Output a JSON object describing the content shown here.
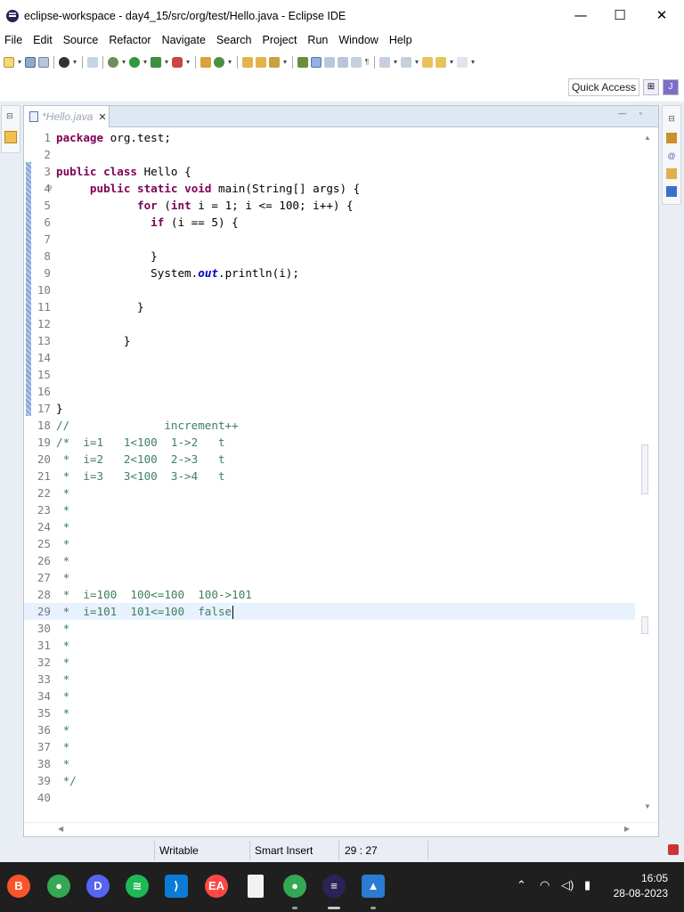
{
  "window": {
    "title": "eclipse-workspace - day4_15/src/org/test/Hello.java - Eclipse IDE",
    "minimize_glyph": "—",
    "maximize_glyph": "☐",
    "close_glyph": "✕"
  },
  "menu": [
    "File",
    "Edit",
    "Source",
    "Refactor",
    "Navigate",
    "Search",
    "Project",
    "Run",
    "Window",
    "Help"
  ],
  "toolbar": {
    "quick_access_label": "Quick Access"
  },
  "editor": {
    "tab_label": "*Hello.java",
    "tab_close_glyph": "✕",
    "lines": [
      {
        "n": "1",
        "html": "<span class=\"kw\">package</span> org.test;"
      },
      {
        "n": "2",
        "html": ""
      },
      {
        "n": "3",
        "html": "<span class=\"kw\">public</span> <span class=\"kw\">class</span> Hello {"
      },
      {
        "n": "4",
        "fold": "⊖",
        "html": "     <span class=\"kw\">public</span> <span class=\"kw\">static</span> <span class=\"kw\">void</span> main(String[] args) {"
      },
      {
        "n": "5",
        "html": "            <span class=\"kw\">for</span> (<span class=\"kw\">int</span> i = 1; i &lt;= 100; i++) {"
      },
      {
        "n": "6",
        "html": "              <span class=\"kw\">if</span> (i == 5) {"
      },
      {
        "n": "7",
        "html": ""
      },
      {
        "n": "8",
        "html": "              }"
      },
      {
        "n": "9",
        "html": "              System.<span class=\"fld\">out</span>.println(i);"
      },
      {
        "n": "10",
        "html": ""
      },
      {
        "n": "11",
        "html": "            }"
      },
      {
        "n": "12",
        "html": ""
      },
      {
        "n": "13",
        "html": "          }"
      },
      {
        "n": "14",
        "html": ""
      },
      {
        "n": "15",
        "html": ""
      },
      {
        "n": "16",
        "html": ""
      },
      {
        "n": "17",
        "html": "}"
      },
      {
        "n": "18",
        "html": "<span class=\"cm\">//              increment++</span>"
      },
      {
        "n": "19",
        "html": "<span class=\"cm\">/*  i=1   1&lt;100  1-&gt;2   t</span>"
      },
      {
        "n": "20",
        "html": "<span class=\"cm\"> *  i=2   2&lt;100  2-&gt;3   t</span>"
      },
      {
        "n": "21",
        "html": "<span class=\"cm\"> *  i=3   3&lt;100  3-&gt;4   t</span>"
      },
      {
        "n": "22",
        "html": "<span class=\"cm\"> *</span>"
      },
      {
        "n": "23",
        "html": "<span class=\"cm\"> *</span>"
      },
      {
        "n": "24",
        "html": "<span class=\"cm\"> *</span>"
      },
      {
        "n": "25",
        "html": "<span class=\"cm\"> *</span>"
      },
      {
        "n": "26",
        "html": "<span class=\"cm\"> *</span>"
      },
      {
        "n": "27",
        "html": "<span class=\"cm\"> *</span>"
      },
      {
        "n": "28",
        "html": "<span class=\"cm\"> *  i=100  100&lt;=100  100-&gt;101</span>"
      },
      {
        "n": "29",
        "current": true,
        "html": "<span class=\"cm\"> *  i=101  101&lt;=100  false</span><span class=\"caret\"></span>"
      },
      {
        "n": "30",
        "html": "<span class=\"cm\"> *</span>"
      },
      {
        "n": "31",
        "html": "<span class=\"cm\"> *</span>"
      },
      {
        "n": "32",
        "html": "<span class=\"cm\"> *</span>"
      },
      {
        "n": "33",
        "html": "<span class=\"cm\"> *</span>"
      },
      {
        "n": "34",
        "html": "<span class=\"cm\"> *</span>"
      },
      {
        "n": "35",
        "html": "<span class=\"cm\"> *</span>"
      },
      {
        "n": "36",
        "html": "<span class=\"cm\"> *</span>"
      },
      {
        "n": "37",
        "html": "<span class=\"cm\"> *</span>"
      },
      {
        "n": "38",
        "html": "<span class=\"cm\"> *</span>"
      },
      {
        "n": "39",
        "html": "<span class=\"cm\"> */</span>"
      },
      {
        "n": "40",
        "html": ""
      }
    ]
  },
  "status": {
    "writable": "Writable",
    "insert_mode": "Smart Insert",
    "cursor_position": "29 : 27"
  },
  "taskbar": {
    "apps": [
      {
        "name": "brave-browser-icon",
        "color": "#fb542b",
        "glyph": "B"
      },
      {
        "name": "chrome-icon",
        "color": "#34a853",
        "glyph": "●"
      },
      {
        "name": "discord-icon",
        "color": "#5865f2",
        "glyph": "D"
      },
      {
        "name": "spotify-icon",
        "color": "#1db954",
        "glyph": "≋"
      },
      {
        "name": "vscode-icon",
        "color": "#0a7bd6",
        "glyph": "⟩"
      },
      {
        "name": "ea-app-icon",
        "color": "#ff4747",
        "glyph": "EA"
      },
      {
        "name": "file-icon",
        "color": "#f2f2f2",
        "glyph": ""
      },
      {
        "name": "chrome-profile-icon",
        "color": "#34a853",
        "glyph": "●"
      },
      {
        "name": "eclipse-icon",
        "color": "#2c2255",
        "glyph": "≡"
      },
      {
        "name": "photos-icon",
        "color": "#2a7bd4",
        "glyph": "▲"
      }
    ],
    "time": "16:05",
    "date": "28-08-2023"
  }
}
